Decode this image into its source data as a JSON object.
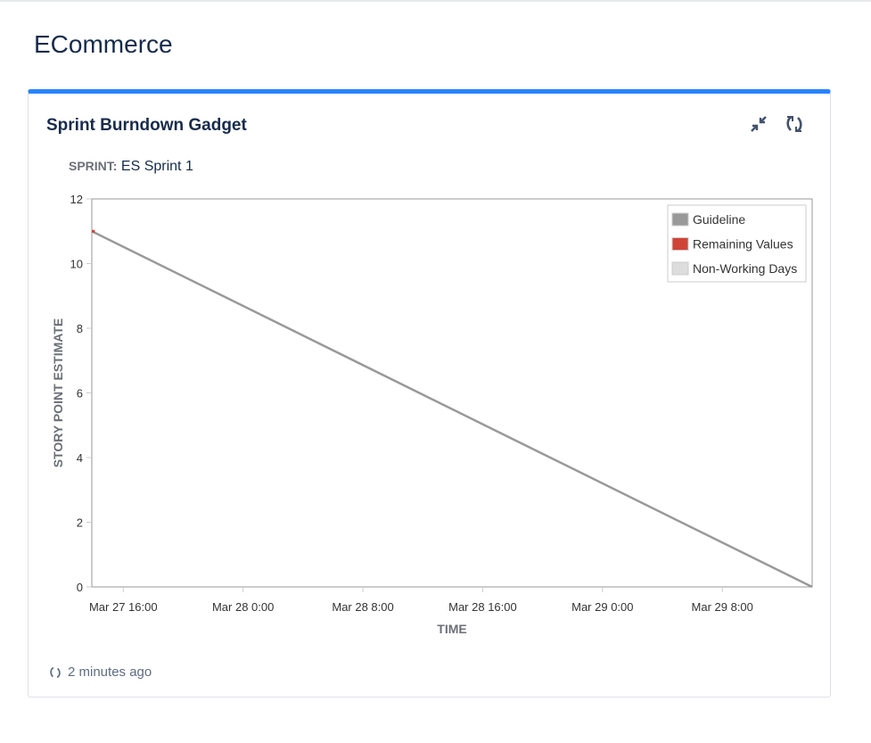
{
  "page_title": "ECommerce",
  "gadget": {
    "title": "Sprint Burndown Gadget",
    "sprint_label": "SPRINT:",
    "sprint_name": "ES Sprint 1",
    "updated": "2 minutes ago",
    "accent": "#2684ff"
  },
  "chart_data": {
    "type": "line",
    "xlabel": "TIME",
    "ylabel": "STORY POINT ESTIMATE",
    "ylim": [
      0,
      12
    ],
    "yticks": [
      0,
      2,
      4,
      6,
      8,
      10,
      12
    ],
    "x_units": "hours since Mar 27 0:00",
    "xlim": [
      13.9,
      62
    ],
    "xticks": [
      {
        "v": 16,
        "label": "Mar 27 16:00"
      },
      {
        "v": 24,
        "label": "Mar 28 0:00"
      },
      {
        "v": 32,
        "label": "Mar 28 8:00"
      },
      {
        "v": 40,
        "label": "Mar 28 16:00"
      },
      {
        "v": 48,
        "label": "Mar 29 0:00"
      },
      {
        "v": 56,
        "label": "Mar 29 8:00"
      }
    ],
    "series": [
      {
        "name": "Guideline",
        "color": "#999999",
        "points": [
          [
            13.9,
            11
          ],
          [
            62,
            0
          ]
        ]
      },
      {
        "name": "Remaining Values",
        "color": "#d04437",
        "points": [
          [
            13.9,
            11
          ],
          [
            14.1,
            11
          ]
        ]
      },
      {
        "name": "Non-Working Days",
        "color": "#dddddd",
        "points": []
      }
    ],
    "legend": "top-right"
  }
}
